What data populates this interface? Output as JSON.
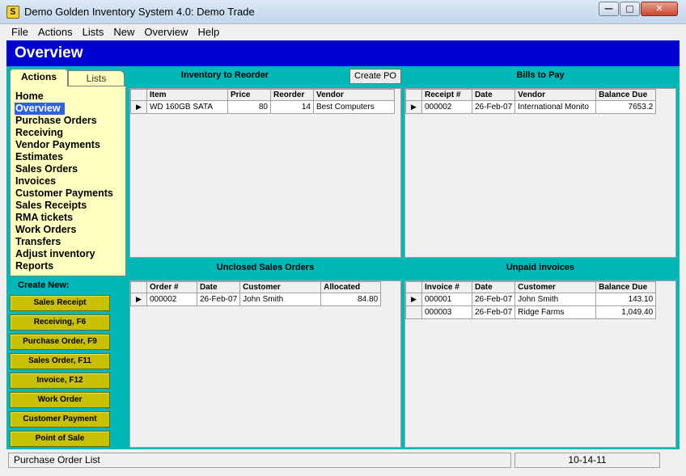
{
  "window": {
    "title": "Demo Golden Inventory System 4.0: Demo Trade",
    "icon_letter": "S",
    "min_glyph": "—",
    "max_glyph": "□",
    "close_glyph": "✕"
  },
  "menu": [
    "File",
    "Actions",
    "Lists",
    "New",
    "Overview",
    "Help"
  ],
  "header": {
    "title": "Overview",
    "color": "#0000d0"
  },
  "tabs": {
    "actions": "Actions",
    "lists": "Lists"
  },
  "nav": {
    "active": "Overview",
    "items": [
      "Home",
      "Overview",
      "Purchase Orders",
      "Receiving",
      "Vendor Payments",
      "Estimates",
      "Sales Orders",
      "Invoices",
      "Customer Payments",
      "Sales Receipts",
      "RMA tickets",
      "Work Orders",
      "Transfers",
      "Adjust inventory",
      "Reports"
    ]
  },
  "create_new": {
    "label": "Create New:",
    "buttons": [
      "Sales Receipt",
      "Receiving, F6",
      "Purchase Order, F9",
      "Sales Order, F11",
      "Invoice, F12",
      "Work Order",
      "Customer Payment",
      "Point of Sale"
    ]
  },
  "reorder": {
    "title": "Inventory to Reorder",
    "create_po": "Create PO",
    "columns": [
      "Item",
      "Price",
      "Reorder",
      "Vendor"
    ],
    "rows": [
      [
        "WD 160GB SATA",
        "80",
        "14",
        "Best Computers"
      ]
    ]
  },
  "bills": {
    "title": "Bills to Pay",
    "columns": [
      "Receipt #",
      "Date",
      "Vendor",
      "Balance Due"
    ],
    "rows": [
      [
        "000002",
        "26-Feb-07",
        "International Monito",
        "7653.2"
      ]
    ]
  },
  "sales_orders": {
    "title": "Unclosed Sales Orders",
    "columns": [
      "Order #",
      "Date",
      "Customer",
      "Allocated"
    ],
    "rows": [
      [
        "000002",
        "26-Feb-07",
        "John Smith",
        "84.80"
      ]
    ]
  },
  "invoices": {
    "title": "Unpaid invoices",
    "columns": [
      "Invoice #",
      "Date",
      "Customer",
      "Balance Due"
    ],
    "rows": [
      [
        "000001",
        "26-Feb-07",
        "John Smith",
        "143.10"
      ],
      [
        "000003",
        "26-Feb-07",
        "Ridge Farms",
        "1,049.40"
      ]
    ]
  },
  "status": {
    "left": "Purchase Order List",
    "right": "10-14-11"
  },
  "colors": {
    "teal": "#00b8b8",
    "nav_bg": "#ffffc0",
    "button_olive": "#c8c000",
    "selection": "#3060e0"
  }
}
